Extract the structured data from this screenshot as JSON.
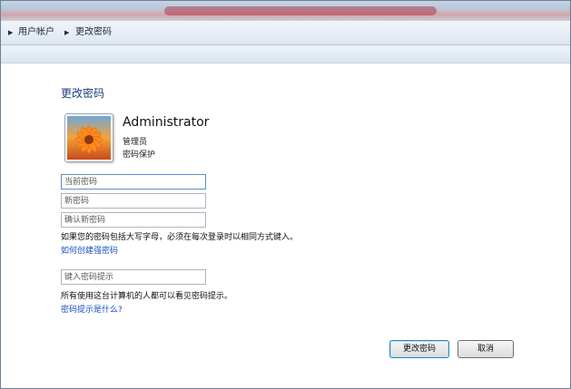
{
  "address_bar": {
    "crumbs": [
      "用户帐户",
      "更改密码"
    ]
  },
  "page": {
    "title": "更改密码"
  },
  "user": {
    "name": "Administrator",
    "role": "管理员",
    "status": "密码保护",
    "avatar_icon": "flower-avatar-icon"
  },
  "form": {
    "current_password_placeholder": "当前密码",
    "new_password_placeholder": "新密码",
    "confirm_password_placeholder": "确认新密码",
    "case_note": "如果您的密码包括大写字母，必须在每次登录时以相同方式键入。",
    "strong_password_link": "如何创建强密码",
    "hint_placeholder": "键入密码提示",
    "hint_note": "所有使用这台计算机的人都可以看见密码提示。",
    "hint_link": "密码提示是什么?"
  },
  "buttons": {
    "change": "更改密码",
    "cancel": "取消"
  },
  "colors": {
    "title_blue": "#1e3d7b",
    "link_blue": "#1a4fbf",
    "frame_border": "#6a7f99"
  }
}
